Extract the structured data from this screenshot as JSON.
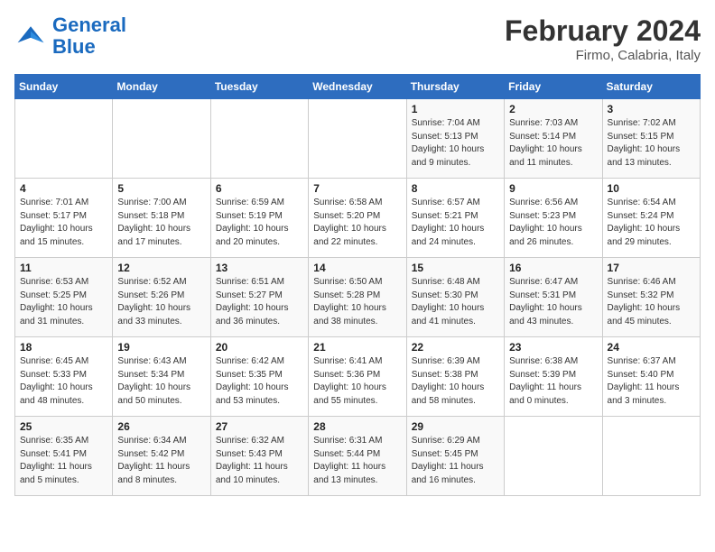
{
  "header": {
    "logo_general": "General",
    "logo_blue": "Blue",
    "month_year": "February 2024",
    "location": "Firmo, Calabria, Italy"
  },
  "weekdays": [
    "Sunday",
    "Monday",
    "Tuesday",
    "Wednesday",
    "Thursday",
    "Friday",
    "Saturday"
  ],
  "weeks": [
    [
      {
        "day": "",
        "info": ""
      },
      {
        "day": "",
        "info": ""
      },
      {
        "day": "",
        "info": ""
      },
      {
        "day": "",
        "info": ""
      },
      {
        "day": "1",
        "info": "Sunrise: 7:04 AM\nSunset: 5:13 PM\nDaylight: 10 hours\nand 9 minutes."
      },
      {
        "day": "2",
        "info": "Sunrise: 7:03 AM\nSunset: 5:14 PM\nDaylight: 10 hours\nand 11 minutes."
      },
      {
        "day": "3",
        "info": "Sunrise: 7:02 AM\nSunset: 5:15 PM\nDaylight: 10 hours\nand 13 minutes."
      }
    ],
    [
      {
        "day": "4",
        "info": "Sunrise: 7:01 AM\nSunset: 5:17 PM\nDaylight: 10 hours\nand 15 minutes."
      },
      {
        "day": "5",
        "info": "Sunrise: 7:00 AM\nSunset: 5:18 PM\nDaylight: 10 hours\nand 17 minutes."
      },
      {
        "day": "6",
        "info": "Sunrise: 6:59 AM\nSunset: 5:19 PM\nDaylight: 10 hours\nand 20 minutes."
      },
      {
        "day": "7",
        "info": "Sunrise: 6:58 AM\nSunset: 5:20 PM\nDaylight: 10 hours\nand 22 minutes."
      },
      {
        "day": "8",
        "info": "Sunrise: 6:57 AM\nSunset: 5:21 PM\nDaylight: 10 hours\nand 24 minutes."
      },
      {
        "day": "9",
        "info": "Sunrise: 6:56 AM\nSunset: 5:23 PM\nDaylight: 10 hours\nand 26 minutes."
      },
      {
        "day": "10",
        "info": "Sunrise: 6:54 AM\nSunset: 5:24 PM\nDaylight: 10 hours\nand 29 minutes."
      }
    ],
    [
      {
        "day": "11",
        "info": "Sunrise: 6:53 AM\nSunset: 5:25 PM\nDaylight: 10 hours\nand 31 minutes."
      },
      {
        "day": "12",
        "info": "Sunrise: 6:52 AM\nSunset: 5:26 PM\nDaylight: 10 hours\nand 33 minutes."
      },
      {
        "day": "13",
        "info": "Sunrise: 6:51 AM\nSunset: 5:27 PM\nDaylight: 10 hours\nand 36 minutes."
      },
      {
        "day": "14",
        "info": "Sunrise: 6:50 AM\nSunset: 5:28 PM\nDaylight: 10 hours\nand 38 minutes."
      },
      {
        "day": "15",
        "info": "Sunrise: 6:48 AM\nSunset: 5:30 PM\nDaylight: 10 hours\nand 41 minutes."
      },
      {
        "day": "16",
        "info": "Sunrise: 6:47 AM\nSunset: 5:31 PM\nDaylight: 10 hours\nand 43 minutes."
      },
      {
        "day": "17",
        "info": "Sunrise: 6:46 AM\nSunset: 5:32 PM\nDaylight: 10 hours\nand 45 minutes."
      }
    ],
    [
      {
        "day": "18",
        "info": "Sunrise: 6:45 AM\nSunset: 5:33 PM\nDaylight: 10 hours\nand 48 minutes."
      },
      {
        "day": "19",
        "info": "Sunrise: 6:43 AM\nSunset: 5:34 PM\nDaylight: 10 hours\nand 50 minutes."
      },
      {
        "day": "20",
        "info": "Sunrise: 6:42 AM\nSunset: 5:35 PM\nDaylight: 10 hours\nand 53 minutes."
      },
      {
        "day": "21",
        "info": "Sunrise: 6:41 AM\nSunset: 5:36 PM\nDaylight: 10 hours\nand 55 minutes."
      },
      {
        "day": "22",
        "info": "Sunrise: 6:39 AM\nSunset: 5:38 PM\nDaylight: 10 hours\nand 58 minutes."
      },
      {
        "day": "23",
        "info": "Sunrise: 6:38 AM\nSunset: 5:39 PM\nDaylight: 11 hours\nand 0 minutes."
      },
      {
        "day": "24",
        "info": "Sunrise: 6:37 AM\nSunset: 5:40 PM\nDaylight: 11 hours\nand 3 minutes."
      }
    ],
    [
      {
        "day": "25",
        "info": "Sunrise: 6:35 AM\nSunset: 5:41 PM\nDaylight: 11 hours\nand 5 minutes."
      },
      {
        "day": "26",
        "info": "Sunrise: 6:34 AM\nSunset: 5:42 PM\nDaylight: 11 hours\nand 8 minutes."
      },
      {
        "day": "27",
        "info": "Sunrise: 6:32 AM\nSunset: 5:43 PM\nDaylight: 11 hours\nand 10 minutes."
      },
      {
        "day": "28",
        "info": "Sunrise: 6:31 AM\nSunset: 5:44 PM\nDaylight: 11 hours\nand 13 minutes."
      },
      {
        "day": "29",
        "info": "Sunrise: 6:29 AM\nSunset: 5:45 PM\nDaylight: 11 hours\nand 16 minutes."
      },
      {
        "day": "",
        "info": ""
      },
      {
        "day": "",
        "info": ""
      }
    ]
  ]
}
